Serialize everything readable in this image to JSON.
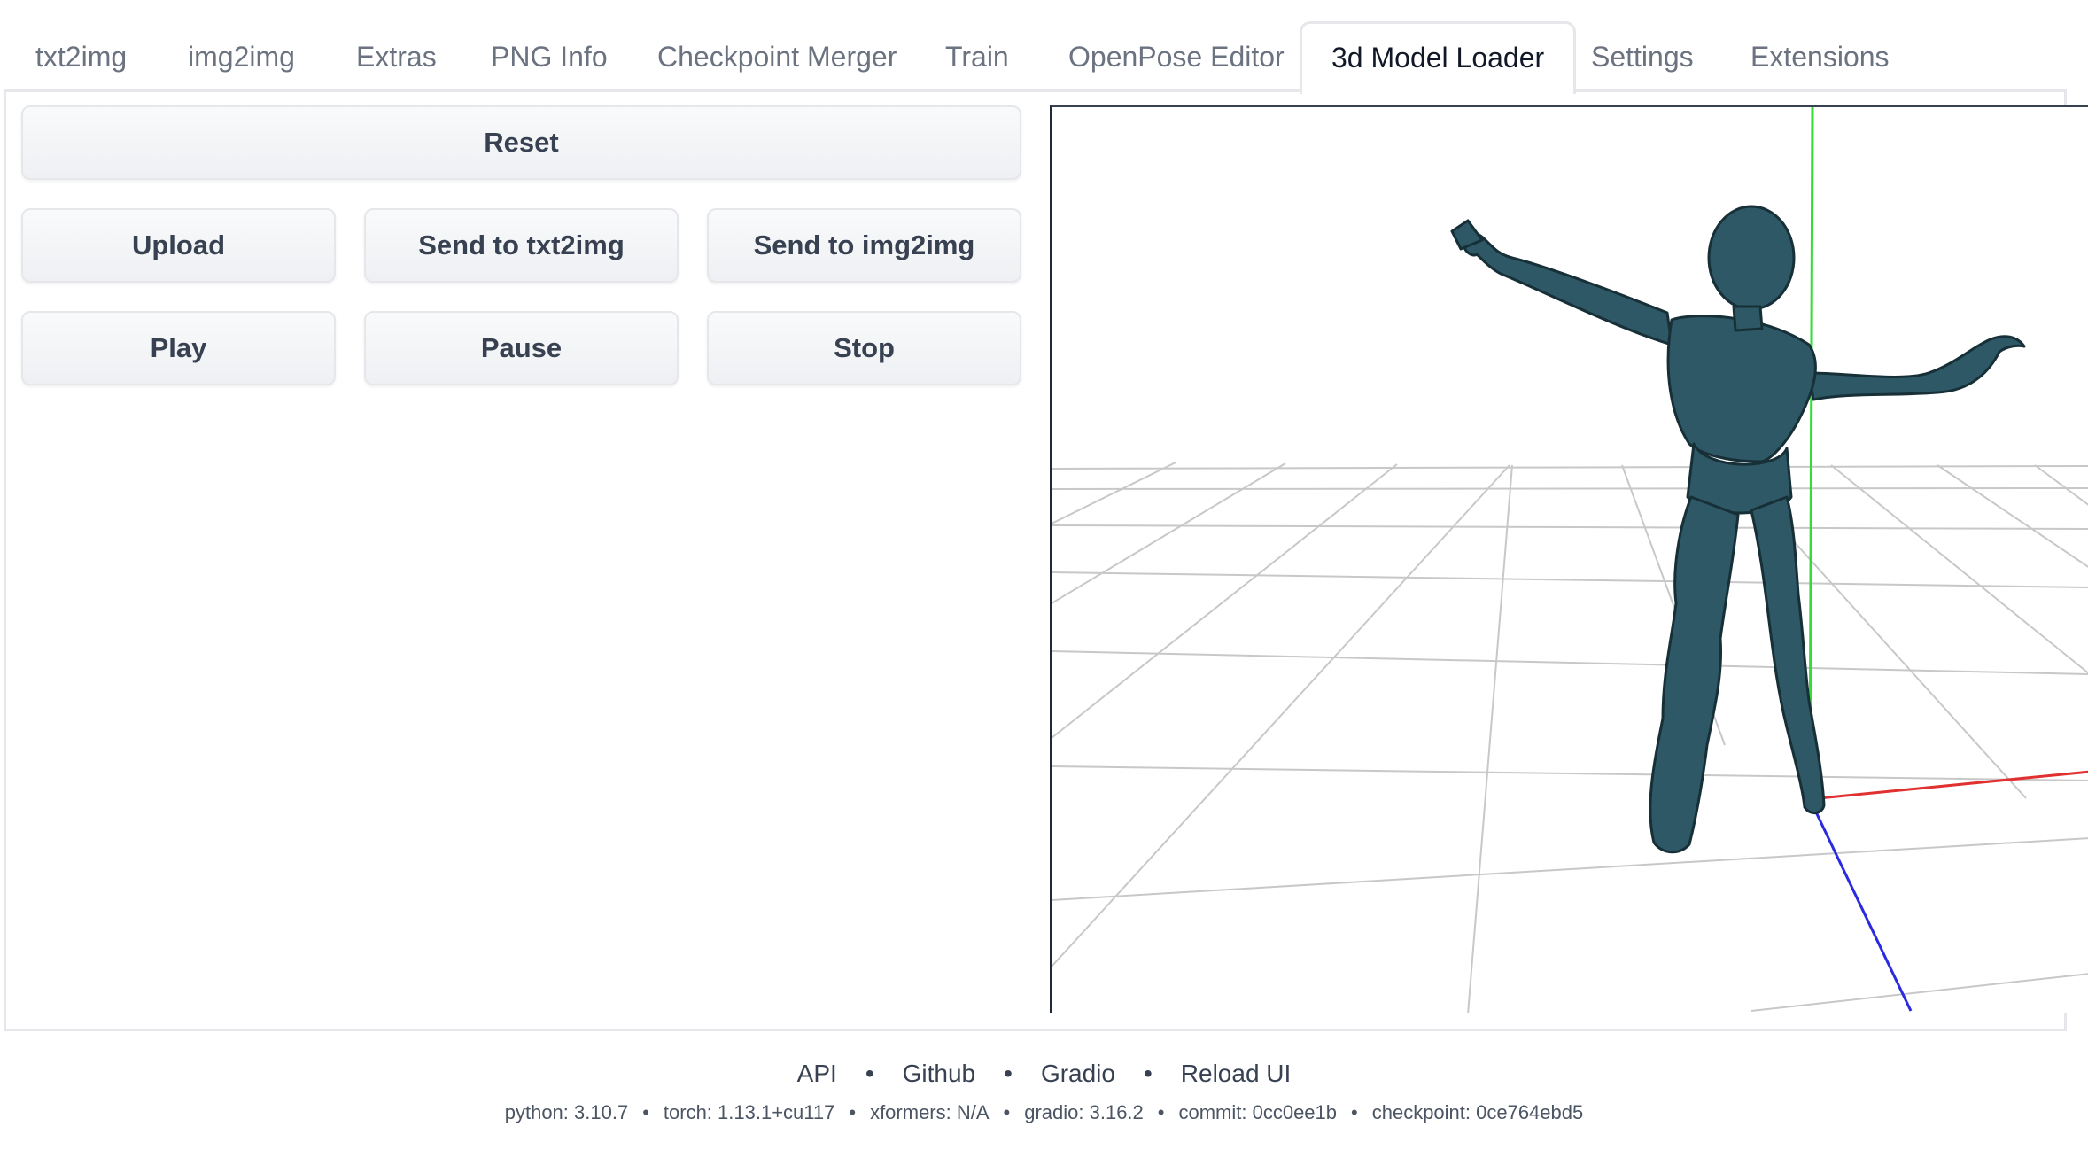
{
  "tabs": [
    {
      "label": "txt2img",
      "active": false
    },
    {
      "label": "img2img",
      "active": false
    },
    {
      "label": "Extras",
      "active": false
    },
    {
      "label": "PNG Info",
      "active": false
    },
    {
      "label": "Checkpoint Merger",
      "active": false
    },
    {
      "label": "Train",
      "active": false
    },
    {
      "label": "OpenPose Editor",
      "active": false
    },
    {
      "label": "3d Model Loader",
      "active": true
    },
    {
      "label": "Settings",
      "active": false
    },
    {
      "label": "Extensions",
      "active": false
    }
  ],
  "controls": {
    "reset": "Reset",
    "upload": "Upload",
    "send_txt2img": "Send to txt2img",
    "send_img2img": "Send to img2img",
    "play": "Play",
    "pause": "Pause",
    "stop": "Stop"
  },
  "footer": {
    "links": [
      "API",
      "Github",
      "Gradio",
      "Reload UI"
    ],
    "info": {
      "python": "python: 3.10.7",
      "torch": "torch: 1.13.1+cu117",
      "xformers": "xformers: N/A",
      "gradio": "gradio: 3.16.2",
      "commit": "commit: 0cc0ee1b",
      "checkpoint": "checkpoint: 0ce764ebd5"
    }
  },
  "colors": {
    "model": "#2e5866",
    "axis_x": "#e03030",
    "axis_y": "#33dd33",
    "axis_z": "#2a2ae0",
    "grid": "#c8c8c8"
  }
}
